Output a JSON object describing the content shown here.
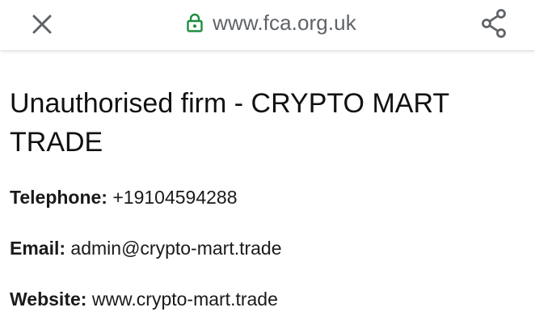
{
  "browser": {
    "url": "www.fca.org.uk",
    "icons": {
      "close": "close-icon",
      "lock": "lock-icon",
      "share": "share-icon"
    },
    "colors": {
      "lock": "#1e8e3e",
      "url_text": "#5f6368",
      "icons": "#5f6368"
    }
  },
  "page": {
    "title": "Unauthorised firm - CRYPTO MART TRADE",
    "telephone": {
      "label": "Telephone:",
      "value": "+19104594288"
    },
    "email": {
      "label": "Email:",
      "value": "admin@crypto-mart.trade"
    },
    "website": {
      "label": "Website:",
      "value": "www.crypto-mart.trade"
    }
  }
}
